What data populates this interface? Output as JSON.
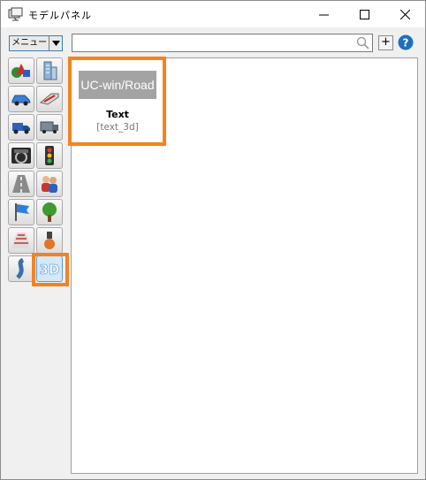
{
  "window": {
    "title": "モデルパネル",
    "buttons": {
      "minimize": "minimize",
      "maximize": "maximize",
      "close": "close"
    }
  },
  "toolbar": {
    "menu_label": "メニュー",
    "search_placeholder": "",
    "search_value": "",
    "add_label": "+"
  },
  "categories": [
    {
      "name": "shapes",
      "icon": "shapes-icon"
    },
    {
      "name": "buildings",
      "icon": "building-icon"
    },
    {
      "name": "cars",
      "icon": "car-icon"
    },
    {
      "name": "trains",
      "icon": "train-icon"
    },
    {
      "name": "trucks",
      "icon": "truck-icon"
    },
    {
      "name": "vehicles-other",
      "icon": "container-truck-icon"
    },
    {
      "name": "cockpits",
      "icon": "cockpit-icon"
    },
    {
      "name": "signals",
      "icon": "traffic-light-icon"
    },
    {
      "name": "roads",
      "icon": "road-icon"
    },
    {
      "name": "characters",
      "icon": "people-icon"
    },
    {
      "name": "flags",
      "icon": "flag-icon"
    },
    {
      "name": "trees",
      "icon": "tree-icon"
    },
    {
      "name": "markings",
      "icon": "crosswalk-icon"
    },
    {
      "name": "misc",
      "icon": "hydrant-icon"
    },
    {
      "name": "splines",
      "icon": "spline-icon"
    },
    {
      "name": "text3d",
      "icon": "text3d-icon",
      "active": true
    }
  ],
  "models": [
    {
      "thumbnail_text": "UC-win/Road",
      "title": "Text",
      "id": "[text_3d]"
    }
  ],
  "colors": {
    "highlight": "#f58220",
    "accent": "#3c7fb1",
    "thumb_bg": "#a3a3a3"
  }
}
